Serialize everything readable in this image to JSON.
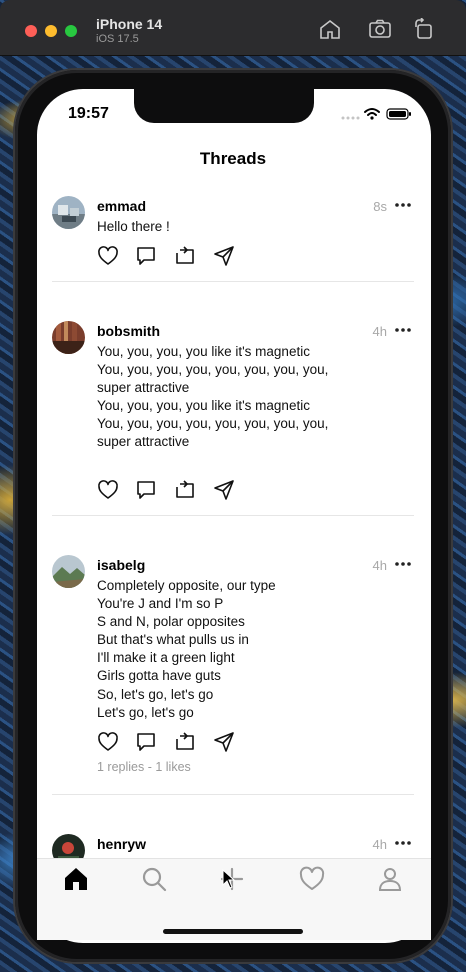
{
  "simulator": {
    "device": "iPhone 14",
    "os": "iOS 17.5",
    "tools": [
      "home-icon",
      "screenshot-icon",
      "rotate-icon"
    ]
  },
  "status_bar": {
    "time": "19:57"
  },
  "nav": {
    "title": "Threads"
  },
  "posts": [
    {
      "username": "emmad",
      "time": "8s",
      "lines": [
        "Hello there !"
      ],
      "meta": ""
    },
    {
      "username": "bobsmith",
      "time": "4h",
      "lines": [
        "You, you, you, you like it's magnetic",
        "You, you, you, you, you, you, you, you,",
        "super attractive",
        "You, you, you, you like it's magnetic",
        "You, you, you, you, you, you, you, you,",
        "super attractive"
      ],
      "meta": ""
    },
    {
      "username": "isabelg",
      "time": "4h",
      "lines": [
        "Completely opposite, our type",
        "You're J and I'm so P",
        "S and N, polar opposites",
        "But that's what pulls us in",
        "I'll make it a green light",
        "Girls gotta have guts",
        "So, let's go, let's go",
        "Let's go, let's go"
      ],
      "meta": "1 replies - 1 likes"
    },
    {
      "username": "henryw",
      "time": "4h",
      "lines": [],
      "meta": ""
    }
  ],
  "tabbar": {
    "tabs": [
      "home-icon",
      "search-icon",
      "plus-icon",
      "heart-icon",
      "profile-icon"
    ],
    "active": "home-icon"
  },
  "colors": {
    "accent": "#000000",
    "muted": "#a8a8a8",
    "divider": "#e6e6e6"
  }
}
